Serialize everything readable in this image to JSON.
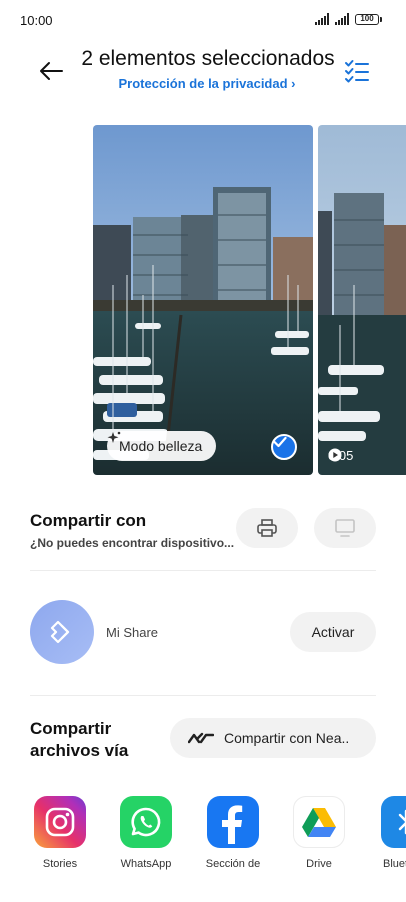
{
  "status_bar": {
    "time": "10:00",
    "battery": "100"
  },
  "header": {
    "title": "2 elementos seleccionados",
    "privacy_link": "Protección de la privacidad",
    "privacy_chevron": "›"
  },
  "media": {
    "beauty_mode_label": "Modo belleza",
    "video_duration": "0:05"
  },
  "share_with": {
    "title": "Compartir con",
    "subtitle": "¿No puedes encontrar dispositivo..."
  },
  "mi_share": {
    "label": "Mi Share",
    "activate_label": "Activar"
  },
  "share_files": {
    "title": "Compartir archivos vía",
    "nearby_label": "Compartir con Nea.."
  },
  "apps": [
    {
      "label": "Stories",
      "icon": "instagram-icon"
    },
    {
      "label": "WhatsApp",
      "icon": "whatsapp-icon"
    },
    {
      "label": "Sección de",
      "icon": "facebook-icon"
    },
    {
      "label": "Drive",
      "icon": "google-drive-icon"
    },
    {
      "label": "Bluet",
      "icon": "bluetooth-icon"
    }
  ],
  "colors": {
    "accent": "#1a73d9",
    "check_badge": "#1a73e8",
    "button_bg": "#f2f2f2",
    "mi_share": "#8ea8ee",
    "whatsapp": "#25d366",
    "facebook": "#1877f2",
    "bluetooth": "#1e88e5"
  }
}
